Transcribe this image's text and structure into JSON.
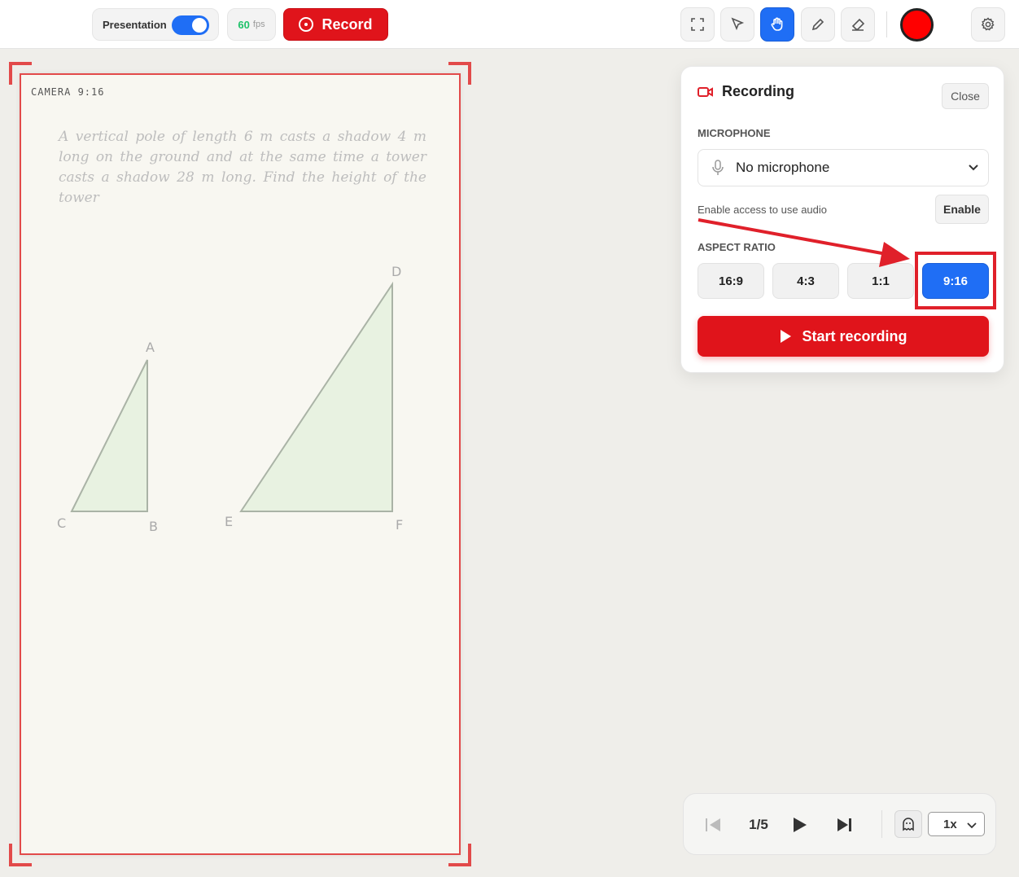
{
  "topbar": {
    "presentation_label": "Presentation",
    "presentation_on": true,
    "fps_value": "60",
    "fps_unit": "fps",
    "record_label": "Record",
    "tools": [
      "fullscreen-icon",
      "pointer-icon",
      "hand-icon",
      "pencil-icon",
      "eraser-icon"
    ],
    "active_tool": "hand-icon",
    "current_color": "#ff0000"
  },
  "canvas": {
    "camera_label": "CAMERA 9:16",
    "question": "A vertical pole of length 6 m casts a shadow 4 m long on the ground and at the same time a tower casts a shadow 28 m long. Find the height of the tower",
    "points": {
      "A": "A",
      "B": "B",
      "C": "C",
      "D": "D",
      "E": "E",
      "F": "F"
    }
  },
  "recording_panel": {
    "title": "Recording",
    "close_label": "Close",
    "microphone_label": "MICROPHONE",
    "microphone_value": "No microphone",
    "enable_hint": "Enable access to use audio",
    "enable_label": "Enable",
    "aspect_ratio_label": "ASPECT RATIO",
    "aspect_ratios": [
      "16:9",
      "4:3",
      "1:1",
      "9:16"
    ],
    "selected_ratio": "9:16",
    "start_label": "Start recording"
  },
  "playback": {
    "page": "1/5",
    "speed": "1x"
  },
  "colors": {
    "accent_blue": "#1f6ef5",
    "record_red": "#e0141b",
    "frame_red": "#e24a4a"
  }
}
